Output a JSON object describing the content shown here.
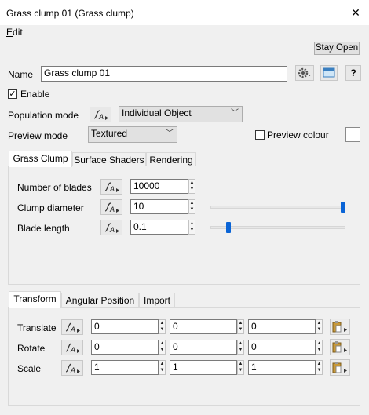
{
  "window": {
    "title": "Grass clump 01    (Grass clump)"
  },
  "menu": {
    "edit_first": "E",
    "edit_rest": "dit"
  },
  "toolbar": {
    "stay_open": "Stay Open"
  },
  "name_row": {
    "label": "Name",
    "value": "Grass clump 01",
    "help": "?"
  },
  "enable": {
    "label": "Enable",
    "checked": true
  },
  "population": {
    "label": "Population mode",
    "value": "Individual Object"
  },
  "preview": {
    "label": "Preview mode",
    "value": "Textured",
    "colour_label": "Preview colour"
  },
  "tabs_top": [
    "Grass Clump",
    "Surface Shaders",
    "Rendering"
  ],
  "grass_clump": {
    "blades_label": "Number of blades",
    "blades_value": "10000",
    "diameter_label": "Clump diameter",
    "diameter_value": "10",
    "diameter_slider": 1.0,
    "length_label": "Blade length",
    "length_value": "0.1",
    "length_slider": 0.12
  },
  "tabs_bottom": [
    "Transform",
    "Angular Position",
    "Import"
  ],
  "transform": {
    "translate_label": "Translate",
    "translate": [
      "0",
      "0",
      "0"
    ],
    "rotate_label": "Rotate",
    "rotate": [
      "0",
      "0",
      "0"
    ],
    "scale_label": "Scale",
    "scale": [
      "1",
      "1",
      "1"
    ]
  },
  "colors": {
    "accent": "#0a64d6"
  }
}
